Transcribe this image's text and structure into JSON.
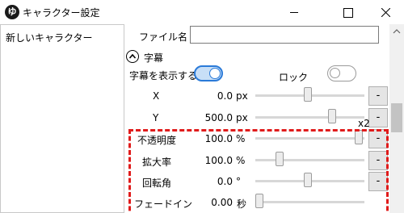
{
  "window": {
    "app_icon_glyph": "ゆ",
    "title": "キャラクター設定",
    "minimize_icon": "minimize-icon",
    "maximize_icon": "maximize-icon",
    "close_icon": "close-icon"
  },
  "character_list": {
    "items": [
      {
        "label": "新しいキャラクター"
      }
    ]
  },
  "settings": {
    "file_name": {
      "label": "ファイル名",
      "value": ""
    },
    "subtitle_section": {
      "label": "字幕",
      "collapse_icon": "chevron-up-icon"
    },
    "show_subtitle": {
      "label": "字幕を表示する",
      "checked": true
    },
    "lock": {
      "label": "ロック",
      "checked": false
    },
    "multiplier_label": "x2",
    "rows": [
      {
        "label": "X",
        "value": "0.0",
        "unit": "px",
        "slider_fraction": 0.48,
        "button_label": "-"
      },
      {
        "label": "Y",
        "value": "500.0",
        "unit": "px",
        "slider_fraction": 0.72,
        "button_label": "-"
      },
      {
        "label": "不透明度",
        "value": "100.0",
        "unit": "%",
        "slider_fraction": 0.98,
        "button_label": "-"
      },
      {
        "label": "拡大率",
        "value": "100.0",
        "unit": "%",
        "slider_fraction": 0.2,
        "button_label": "-"
      },
      {
        "label": "回転角",
        "value": "0.0",
        "unit": "°",
        "slider_fraction": 0.48,
        "button_label": "-"
      },
      {
        "label": "フェードイン",
        "value": "0.00",
        "unit": "秒",
        "slider_fraction": 0.0
      }
    ]
  },
  "colors": {
    "highlight": "#e01b1b",
    "toggle_on": "#2a7ad8"
  }
}
